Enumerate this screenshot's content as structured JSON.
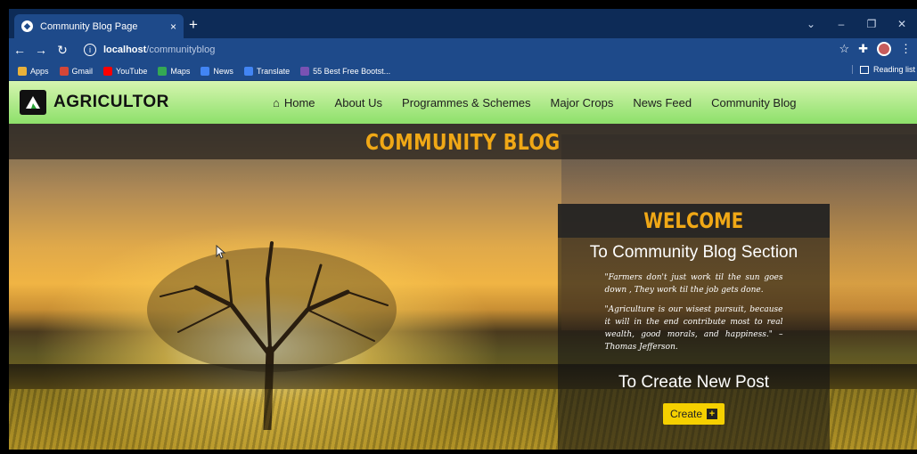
{
  "browser": {
    "tab_title": "Community Blog Page",
    "new_tab": "+",
    "close_tab": "×",
    "url_host": "localhost",
    "url_path": "/communityblog",
    "window_controls": [
      "⌄",
      "–",
      "❐",
      "✕"
    ],
    "bookmarks": [
      {
        "label": "Apps",
        "color": "#e8b13b"
      },
      {
        "label": "Gmail",
        "color": "#d44638"
      },
      {
        "label": "YouTube",
        "color": "#ff0000"
      },
      {
        "label": "Maps",
        "color": "#34a853"
      },
      {
        "label": "News",
        "color": "#4285f4"
      },
      {
        "label": "Translate",
        "color": "#4285f4"
      },
      {
        "label": "55 Best Free Bootst...",
        "color": "#7952b3"
      }
    ],
    "reading_list": "Reading list"
  },
  "site": {
    "brand": "AGRICULTOR",
    "nav": [
      "Home",
      "About Us",
      "Programmes & Schemes",
      "Major Crops",
      "News Feed",
      "Community Blog"
    ],
    "banner_title": "COMMUNITY BLOG",
    "welcome": {
      "title": "WELCOME",
      "subtitle": "To Community Blog Section",
      "quote1": "\"Farmers don't just work til the sun goes down , They work til the job gets done.",
      "quote2": "\"Agriculture is our wisest pursuit, because it will in the end contribute most to real wealth, good morals, and happiness.\" – Thomas Jefferson.",
      "create_heading": "To Create New Post",
      "create_button": "Create"
    }
  },
  "colors": {
    "accent": "#f0a816",
    "navbar": "#8de06a",
    "button": "#f5d000",
    "chrome": "#1e4a8a"
  }
}
